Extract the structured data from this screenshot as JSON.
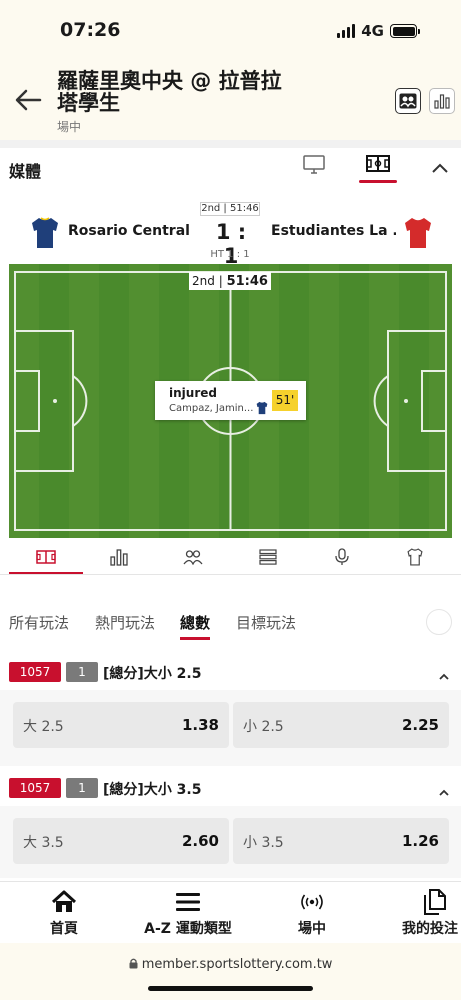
{
  "status": {
    "time": "07:26",
    "network": "4G"
  },
  "header": {
    "title": "羅薩里奧中央 @ 拉普拉塔學生",
    "subtitle": "場中"
  },
  "media": {
    "label": "媒體"
  },
  "match": {
    "period_clock": "2nd | 51:46",
    "home_team": "Rosario Central",
    "away_team": "Estudiantes La ...",
    "score": "1 : 1",
    "ht_score": "HT 1 : 1",
    "home_color": "#1f3f7a",
    "away_color": "#d42b2b"
  },
  "pitch": {
    "period": "2nd",
    "clock": "51:46",
    "event": {
      "title": "injured",
      "player": "Campaz, Jamin...",
      "minute": "51'"
    }
  },
  "stat_tabs": [
    "pitch-icon",
    "bar-chart-icon",
    "lineup-icon",
    "list-icon",
    "microphone-icon",
    "shirt-icon"
  ],
  "market_tabs": [
    "所有玩法",
    "熱門玩法",
    "總數",
    "目標玩法"
  ],
  "markets": [
    {
      "code": "1057",
      "num": "1",
      "title": "[總分]大小 2.5",
      "over_label": "大 2.5",
      "over_odds": "1.38",
      "under_label": "小 2.5",
      "under_odds": "2.25"
    },
    {
      "code": "1057",
      "num": "1",
      "title": "[總分]大小 3.5",
      "over_label": "大 3.5",
      "over_odds": "2.60",
      "under_label": "小 3.5",
      "under_odds": "1.26"
    }
  ],
  "bottom_nav": [
    {
      "label": "首頁",
      "icon": "home-icon"
    },
    {
      "label": "A-Z 運動類型",
      "icon": "menu-icon"
    },
    {
      "label": "場中",
      "icon": "live-icon"
    },
    {
      "label": "我的投注",
      "icon": "bets-icon"
    }
  ],
  "url": "member.sportslottery.com.tw",
  "colors": {
    "accent": "#c8102e",
    "highlight": "#f6d12c",
    "pitch": "#4a8a2c"
  }
}
